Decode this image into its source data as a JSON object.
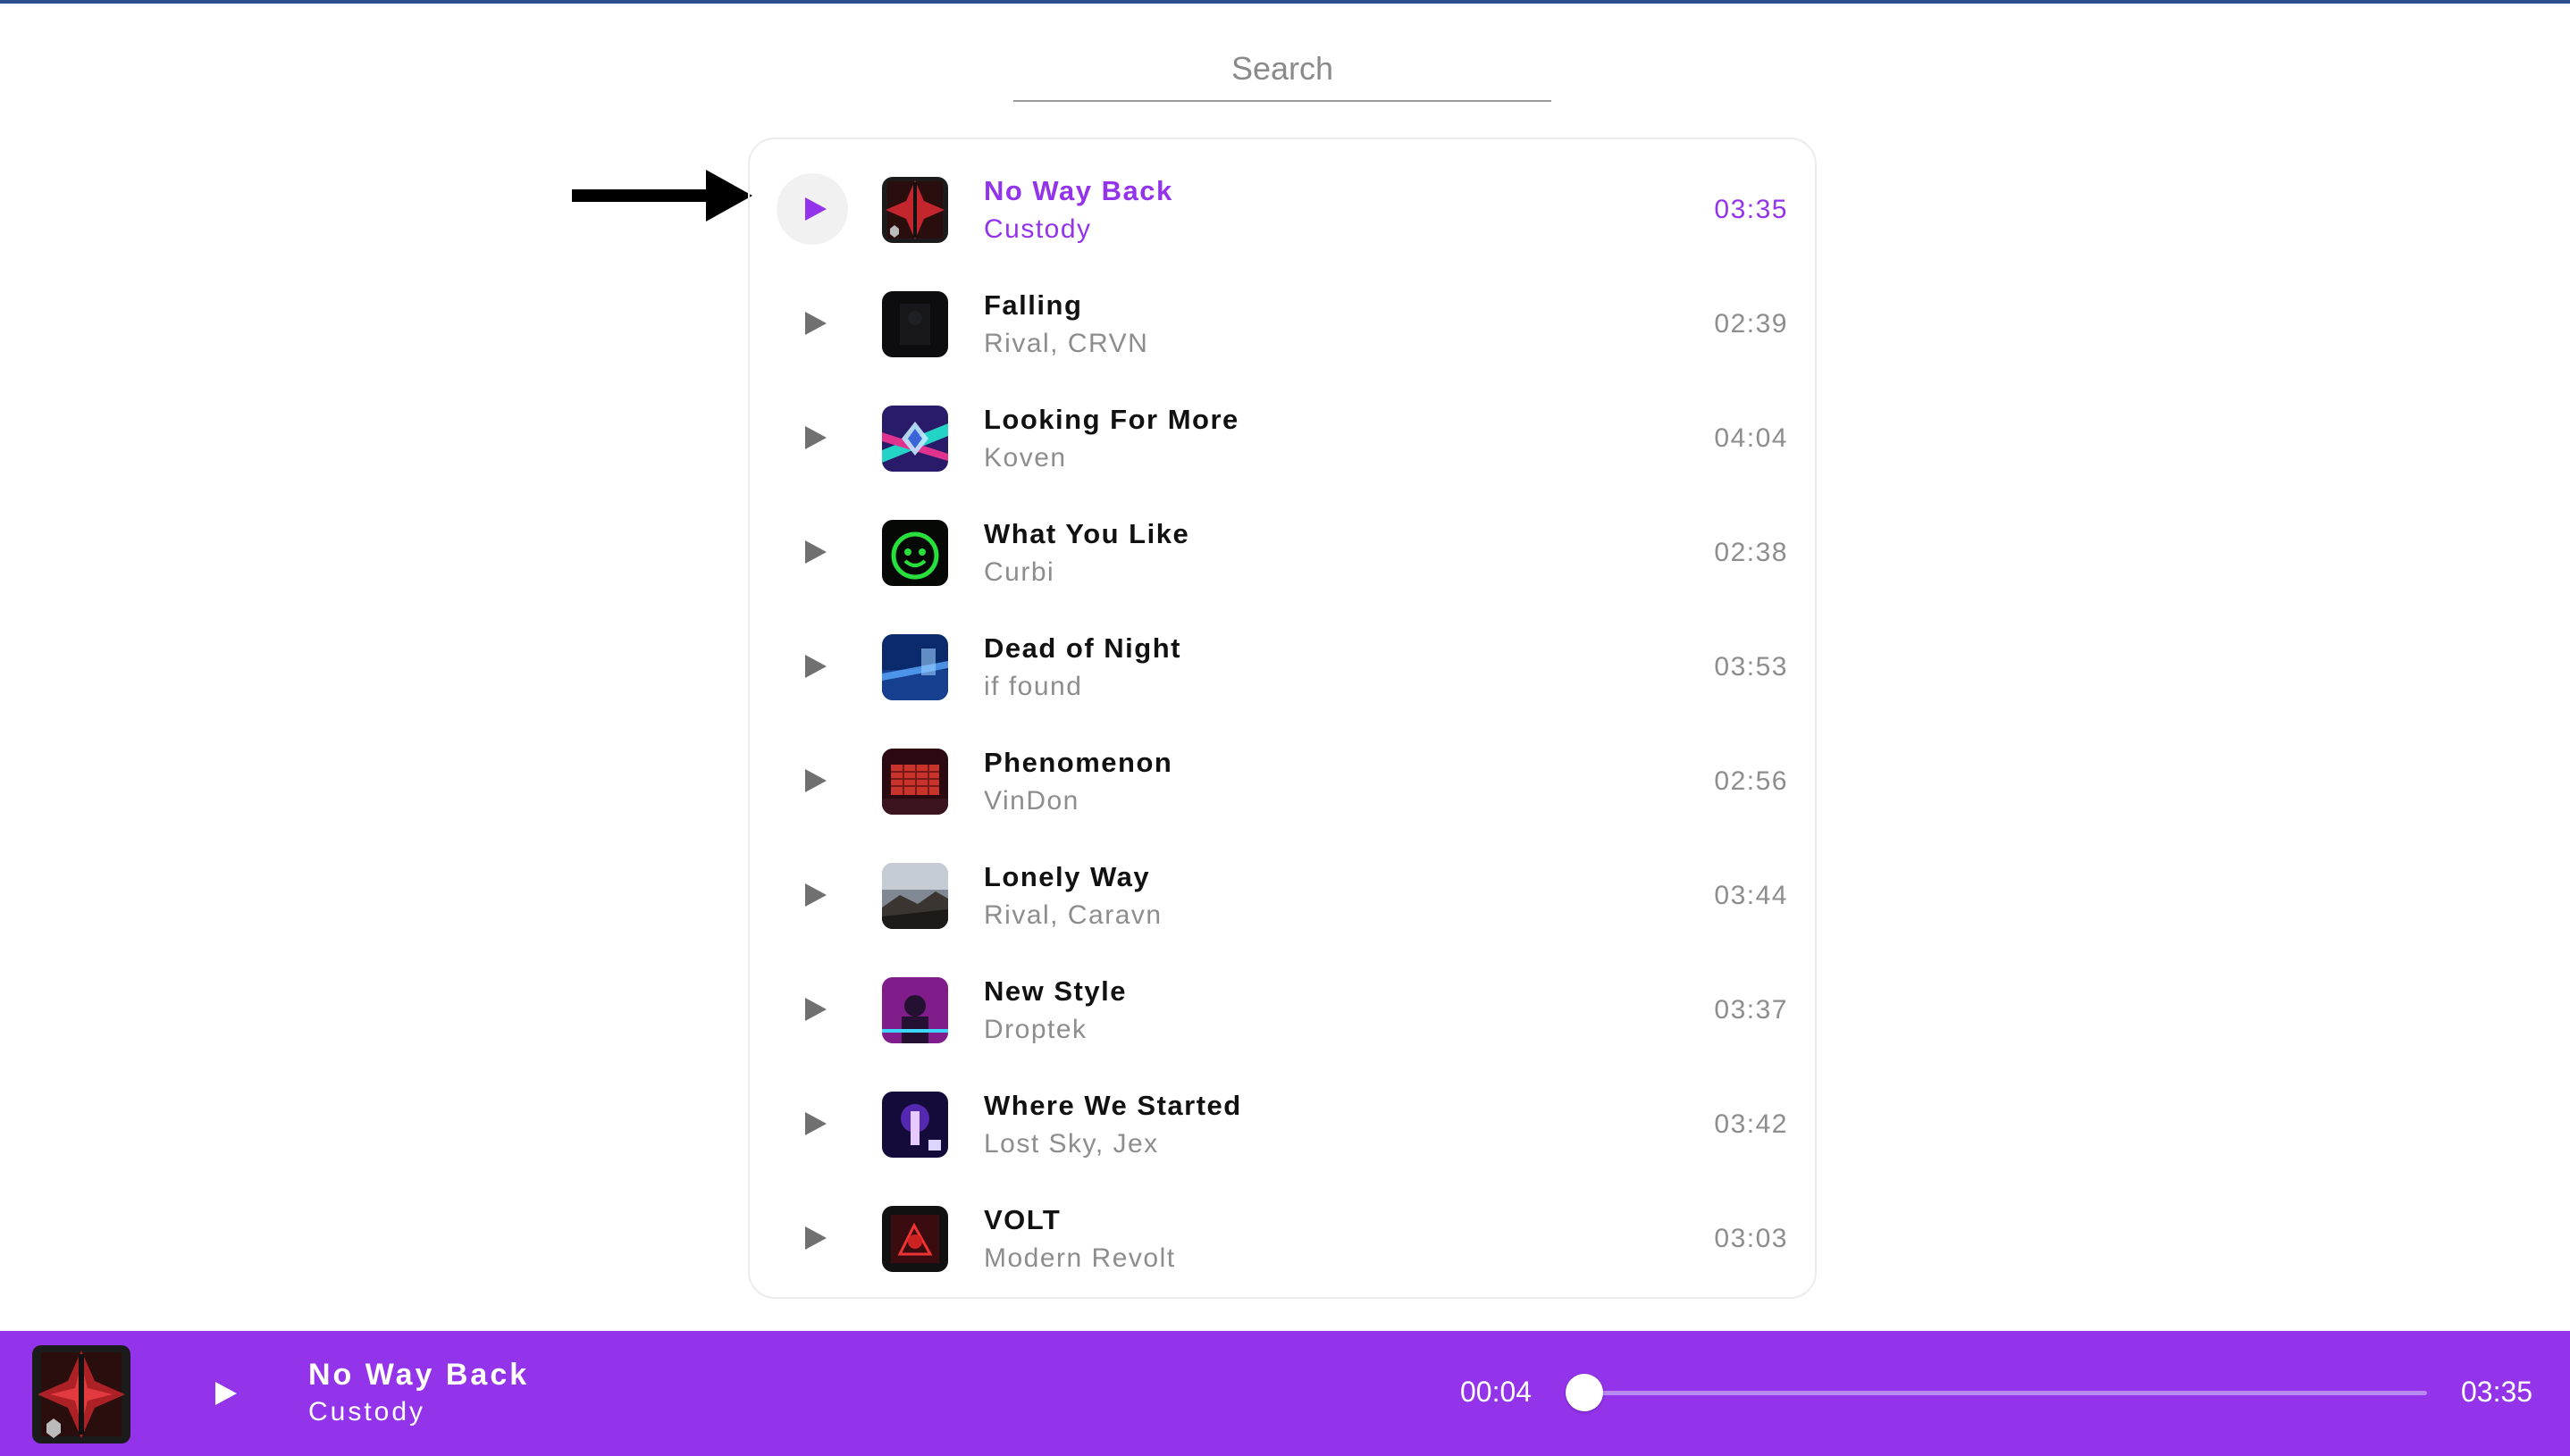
{
  "search": {
    "placeholder": "Search",
    "value": ""
  },
  "tracks": [
    {
      "title": "No Way Back",
      "artist": "Custody",
      "duration": "03:35",
      "active": true,
      "cover": "red"
    },
    {
      "title": "Falling",
      "artist": "Rival, CRVN",
      "duration": "02:39",
      "active": false,
      "cover": "dark"
    },
    {
      "title": "Looking For More",
      "artist": "Koven",
      "duration": "04:04",
      "active": false,
      "cover": "neon"
    },
    {
      "title": "What You Like",
      "artist": "Curbi",
      "duration": "02:38",
      "active": false,
      "cover": "green"
    },
    {
      "title": "Dead of Night",
      "artist": "if found",
      "duration": "03:53",
      "active": false,
      "cover": "blue"
    },
    {
      "title": "Phenomenon",
      "artist": "VinDon",
      "duration": "02:56",
      "active": false,
      "cover": "redgrid"
    },
    {
      "title": "Lonely Way",
      "artist": "Rival, Caravn",
      "duration": "03:44",
      "active": false,
      "cover": "sky"
    },
    {
      "title": "New Style",
      "artist": "Droptek",
      "duration": "03:37",
      "active": false,
      "cover": "magenta"
    },
    {
      "title": "Where We Started",
      "artist": "Lost Sky, Jex",
      "duration": "03:42",
      "active": false,
      "cover": "violet"
    },
    {
      "title": "VOLT",
      "artist": "Modern Revolt",
      "duration": "03:03",
      "active": false,
      "cover": "volt"
    }
  ],
  "player": {
    "title": "No Way Back",
    "artist": "Custody",
    "current_time": "00:04",
    "total_time": "03:35",
    "progress_fraction": 0.02
  },
  "colors": {
    "accent": "#9333ea",
    "play_icon_inactive": "#707070",
    "text_muted": "#8d8d8d"
  },
  "icons": {
    "row_play": "play-icon",
    "player_play": "play-icon",
    "pointer": "arrow-right-icon"
  }
}
